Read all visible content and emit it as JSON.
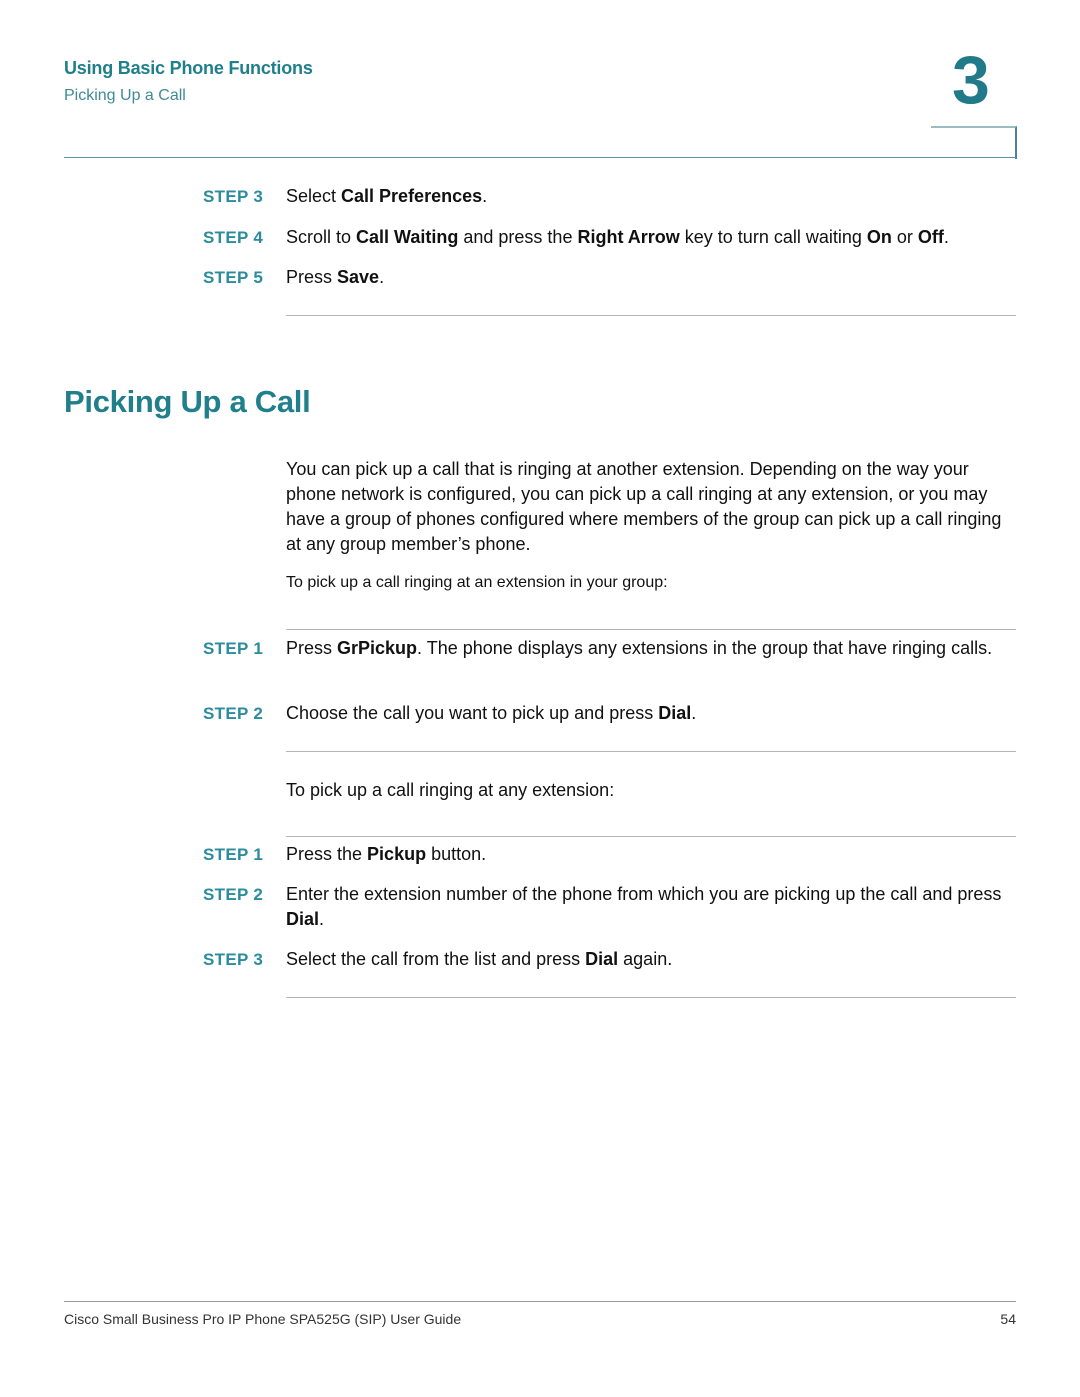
{
  "header": {
    "chapter_title": "Using Basic Phone Functions",
    "section_title": "Picking Up a Call",
    "chapter_number": "3"
  },
  "top_steps": [
    {
      "label": "STEP 3",
      "parts": [
        "Select ",
        "Call Preferences",
        "."
      ]
    },
    {
      "label": "STEP 4",
      "parts": [
        "Scroll to ",
        "Call Waiting",
        " and press the ",
        "Right Arrow",
        " key to turn call waiting ",
        "On",
        " or ",
        "Off",
        "."
      ]
    },
    {
      "label": "STEP 5",
      "parts": [
        "Press ",
        "Save",
        "."
      ]
    }
  ],
  "section": {
    "title": "Picking Up a Call",
    "intro": "You can pick up a call that is ringing at another extension. Depending on the way your phone network is configured, you can pick up a call ringing at any extension, or you may have a group of phones configured where members of the group can pick up a call ringing at any group member’s phone.",
    "group_lead_in": "To pick up a call ringing at an extension in your group:",
    "group_steps": [
      {
        "label": "STEP 1",
        "parts": [
          "Press ",
          "GrPickup",
          ". The phone displays any extensions in the group that have ringing calls."
        ]
      },
      {
        "label": "STEP 2",
        "parts": [
          "Choose the call you want to pick up and press ",
          "Dial",
          "."
        ]
      }
    ],
    "any_lead_in": "To pick up a call ringing at any extension:",
    "any_steps": [
      {
        "label": "STEP 1",
        "parts": [
          "Press the ",
          "Pickup",
          " button."
        ]
      },
      {
        "label": "STEP 2",
        "parts": [
          "Enter the extension number of the phone from which you are picking up the call and press ",
          "Dial",
          "."
        ]
      },
      {
        "label": "STEP 3",
        "parts": [
          "Select the call from the list and press ",
          "Dial",
          " again."
        ]
      }
    ]
  },
  "footer": {
    "title": "Cisco Small Business Pro IP Phone SPA525G (SIP) User Guide",
    "page_number": "54"
  },
  "colors": {
    "accent": "#217f8c",
    "step_label": "#2a8c9c",
    "rule": "#b5b5b5"
  }
}
